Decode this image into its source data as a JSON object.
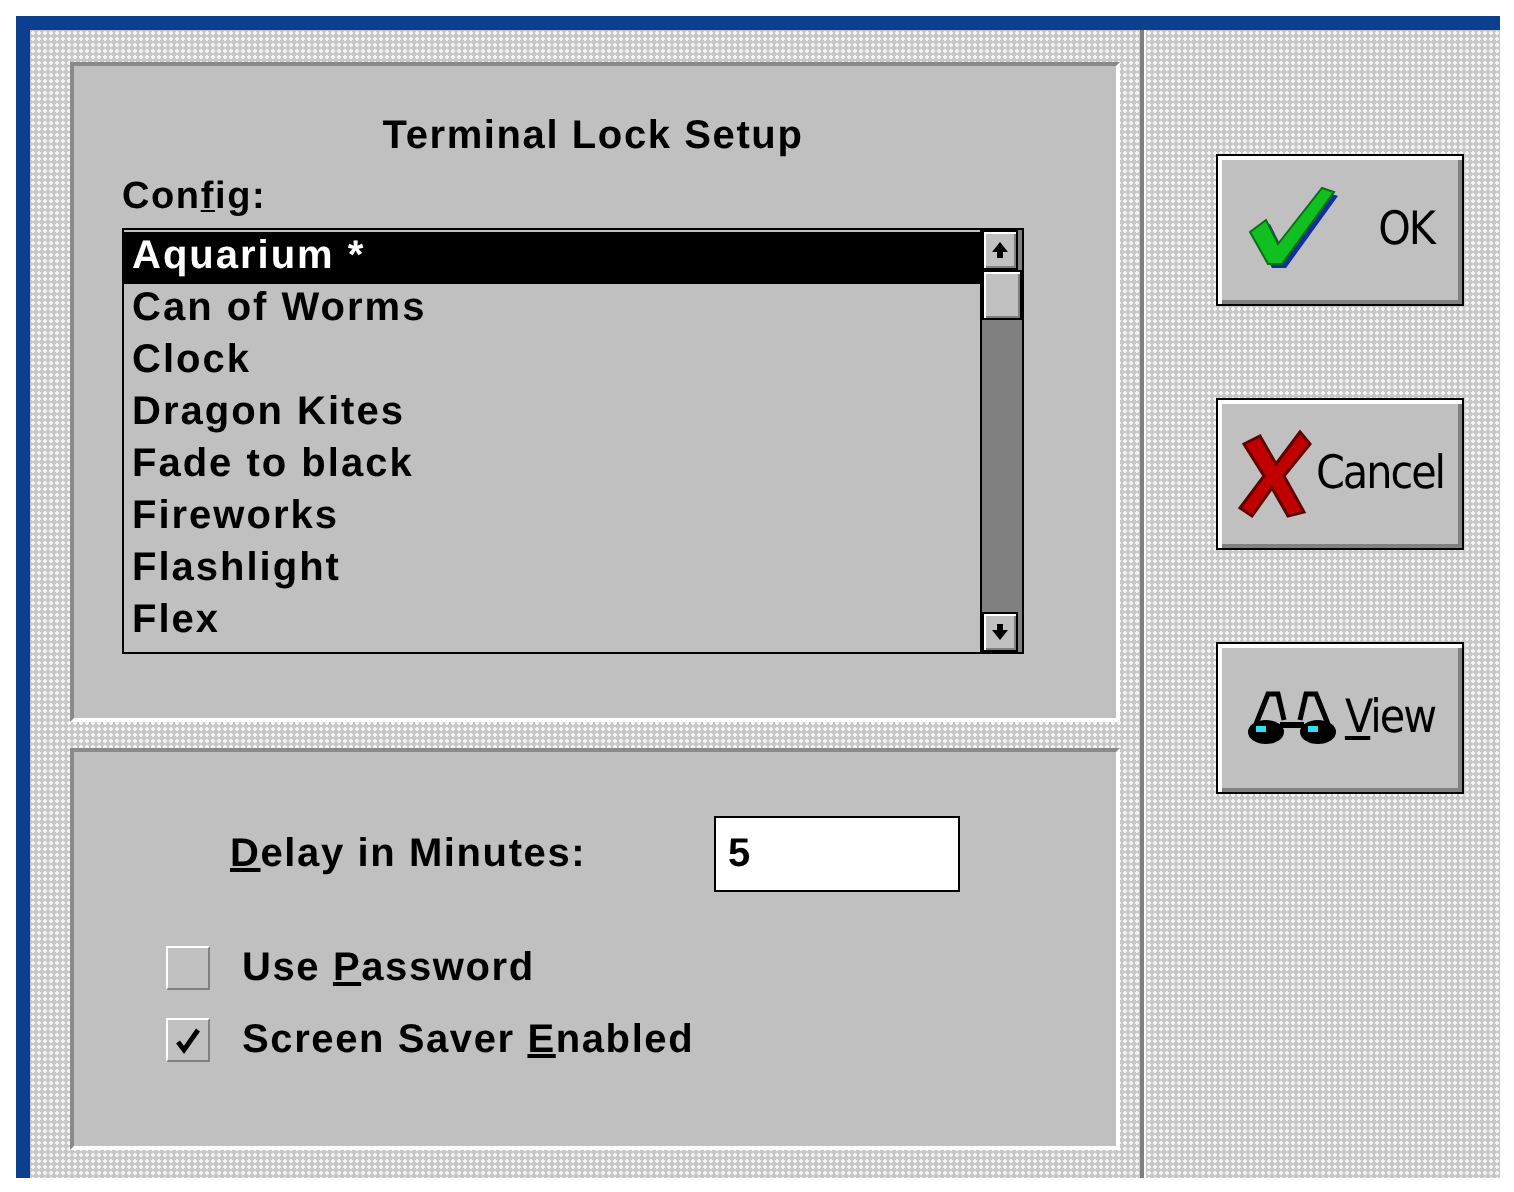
{
  "panel_title": "Terminal Lock Setup",
  "config": {
    "label": [
      {
        "text": "Con",
        "underlined": false
      },
      {
        "text": "f",
        "underlined": true
      },
      {
        "text": "ig:",
        "underlined": false
      }
    ],
    "items": [
      {
        "label": "Aquarium *",
        "selected": true
      },
      {
        "label": "Can of Worms",
        "selected": false
      },
      {
        "label": "Clock",
        "selected": false
      },
      {
        "label": "Dragon Kites",
        "selected": false
      },
      {
        "label": "Fade to black",
        "selected": false
      },
      {
        "label": "Fireworks",
        "selected": false
      },
      {
        "label": "Flashlight",
        "selected": false
      },
      {
        "label": "Flex",
        "selected": false
      }
    ]
  },
  "delay": {
    "label": [
      {
        "text": "D",
        "underlined": true
      },
      {
        "text": "elay in Minutes:",
        "underlined": false
      }
    ],
    "value": "5"
  },
  "options": [
    {
      "label": [
        {
          "text": "Use ",
          "underlined": false
        },
        {
          "text": "P",
          "underlined": true
        },
        {
          "text": "assword",
          "underlined": false
        }
      ],
      "checked": false
    },
    {
      "label": [
        {
          "text": "Screen Saver ",
          "underlined": false
        },
        {
          "text": "E",
          "underlined": true
        },
        {
          "text": "nabled",
          "underlined": false
        }
      ],
      "checked": true
    }
  ],
  "buttons": [
    {
      "kind": "ok",
      "label": [
        {
          "text": "OK",
          "underlined": false
        }
      ]
    },
    {
      "kind": "cancel",
      "label": [
        {
          "text": "Cancel",
          "underlined": false
        }
      ]
    },
    {
      "kind": "view",
      "label": [
        {
          "text": "V",
          "underlined": true
        },
        {
          "text": "iew",
          "underlined": false
        }
      ]
    }
  ]
}
